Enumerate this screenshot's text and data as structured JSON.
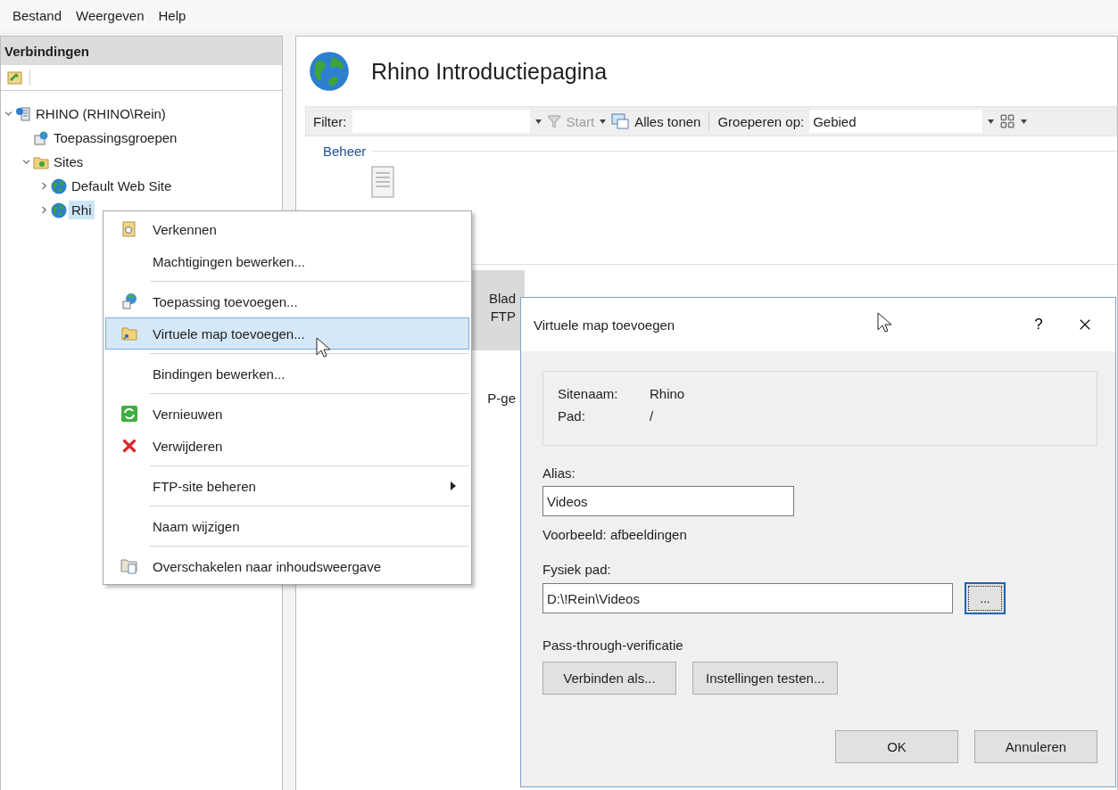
{
  "menu_bar": [
    "Bestand",
    "Weergeven",
    "Help"
  ],
  "connections": {
    "title": "Verbindingen",
    "tree": [
      {
        "label": "RHINO (RHINO\\Rein)",
        "kind": "server",
        "expanded": true,
        "selected": false,
        "children": [
          {
            "label": "Toepassingsgroepen",
            "kind": "pools",
            "selected": false
          },
          {
            "label": "Sites",
            "kind": "sites",
            "expanded": true,
            "selected": false,
            "children": [
              {
                "label": "Default Web Site",
                "kind": "site",
                "expanded": false,
                "selected": false
              },
              {
                "label": "Rhi",
                "kind": "site",
                "expanded": false,
                "selected": true
              }
            ]
          }
        ]
      }
    ]
  },
  "page": {
    "title": "Rhino Introductiepagina",
    "toolbar": {
      "filter_label": "Filter:",
      "start": {
        "label": "Start",
        "disabled": true
      },
      "show_all": "Alles tonen",
      "group_by_label": "Groeperen op:",
      "group_by_value": "Gebied"
    },
    "group_title": "Beheer",
    "tiles": [
      {
        "lines": [
          "Blad",
          "FTP"
        ],
        "selected": true
      },
      {
        "lines": [
          "P-ge"
        ],
        "selected": false
      }
    ]
  },
  "context_menu": [
    {
      "kind": "explore",
      "label": "Verkennen",
      "selected": false
    },
    {
      "kind": "plain",
      "label": "Machtigingen bewerken...",
      "selected": false
    },
    {
      "kind": "separator"
    },
    {
      "kind": "application",
      "label": "Toepassing toevoegen...",
      "selected": false
    },
    {
      "kind": "folder",
      "label": "Virtuele map toevoegen...",
      "selected": true
    },
    {
      "kind": "separator"
    },
    {
      "kind": "plain",
      "label": "Bindingen bewerken...",
      "selected": false
    },
    {
      "kind": "separator"
    },
    {
      "kind": "refresh",
      "label": "Vernieuwen",
      "selected": false
    },
    {
      "kind": "delete",
      "label": "Verwijderen",
      "selected": false
    },
    {
      "kind": "separator"
    },
    {
      "kind": "submenu",
      "label": "FTP-site beheren",
      "selected": false
    },
    {
      "kind": "separator"
    },
    {
      "kind": "plain",
      "label": "Naam wijzigen",
      "selected": false
    },
    {
      "kind": "separator"
    },
    {
      "kind": "switch",
      "label": "Overschakelen naar inhoudsweergave",
      "selected": false
    }
  ],
  "dialog": {
    "title": "Virtuele map toevoegen",
    "help": "?",
    "info": [
      {
        "label": "Sitenaam:",
        "value": "Rhino"
      },
      {
        "label": "Pad:",
        "value": "/"
      }
    ],
    "alias": {
      "label": "Alias:",
      "value": "Videos",
      "example": "Voorbeeld: afbeeldingen"
    },
    "physical_path": {
      "label": "Fysiek pad:",
      "value": "D:\\!Rein\\Videos",
      "browse": "...",
      "browse_focused": true
    },
    "pass_through": {
      "label": "Pass-through-verificatie",
      "buttons": [
        "Verbinden als...",
        "Instellingen testen..."
      ]
    },
    "buttons": [
      "OK",
      "Annuleren"
    ]
  }
}
